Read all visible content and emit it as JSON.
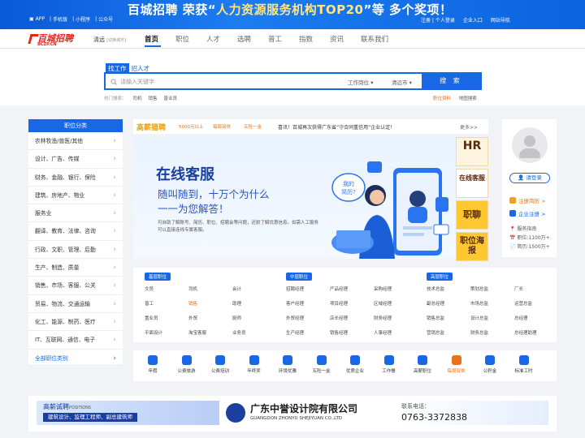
{
  "topbar": {
    "links": [
      "APP",
      "手机版",
      "小程序",
      "公众号"
    ],
    "banner_brand": "百城招聘",
    "banner_text_1": "荣获“",
    "banner_highlight": "人力资源服务机构TOP20",
    "banner_text_2": "”等 多个奖项！",
    "register_login": "注册 | 个人登录",
    "enterprise_entry": "企业入口",
    "site_nav": "网站导航"
  },
  "header": {
    "logo_main": "百城招聘",
    "logo_sub": "BCZP.CN",
    "city": "清远",
    "switch_city": "[切换城市]",
    "menu": [
      "首页",
      "职位",
      "人才",
      "选聘",
      "普工",
      "指数",
      "资讯",
      "联系我们"
    ],
    "active_menu": "首页"
  },
  "search": {
    "tab_jobs": "找工作",
    "tab_talent": "招人才",
    "placeholder": "请输入关键字",
    "job_type": "工作岗位",
    "city_select": "清远市",
    "button": "搜 索",
    "hot_label": "热门搜索：",
    "hot_terms": [
      "司机",
      "销售",
      "普业员"
    ],
    "fill_resume": "职位资料",
    "map_search": "地图搜索"
  },
  "categories": {
    "title": "职位分类",
    "items": [
      "农林牧渔/兽医/其他",
      "设计、广告、传媒",
      "财务、金融、银行、保险",
      "建筑、房地产、物业",
      "服务业",
      "翻译、教育、法律、咨询",
      "行政、文职、管理、后勤",
      "生产、制造、质量",
      "销售、市场、客服、公关",
      "贸易、物流、交通运输",
      "化工、能源、制药、医疗",
      "IT、互联网、通信、电子",
      "全部职位类别"
    ]
  },
  "ticker": {
    "brand": "高薪猎聘",
    "tags": [
      "5000元以上",
      "每周双休",
      "五险一金"
    ],
    "notice": "喜讯！百城再次获得广东省“守合同重信用”企业认定！",
    "more": "更多>>"
  },
  "hero": {
    "title": "在线客服",
    "line1": "随叫随到，十万个为什么",
    "line2": "一一为您解答！",
    "desc": "可自助了解账号、简历、职位、招聘会等问题，还耐了解优惠信息。如需人工服务可以直接连线专属客服。",
    "bubble": "我的简历?",
    "side_ads": [
      "HR",
      "在线客服",
      "职聊",
      "职位海报"
    ]
  },
  "user": {
    "login": "请登录",
    "register_resume": "注册简历 >",
    "register_company": "企业注册 >",
    "guide": "服务指南",
    "jobs_count": "职位:1100万+",
    "resume_count": "简历:1500万+"
  },
  "job_groups": [
    {
      "label": "基层职位",
      "items": [
        "文员",
        "司机",
        "会计",
        "普工",
        "销售",
        "助理",
        "置业员",
        "外贸",
        "厨师",
        "平面设计",
        "淘宝客服",
        "业务员"
      ],
      "highlight": "销售"
    },
    {
      "label": "中层职位",
      "items": [
        "招聘经理",
        "产品经理",
        "采购经理",
        "客户经理",
        "项目经理",
        "区域经理",
        "外贸经理",
        "店长经理",
        "财务经理",
        "生产经理",
        "销售经理",
        "人事经理"
      ]
    },
    {
      "label": "高层职位",
      "items": [
        "技术总监",
        "策划总监",
        "厂长",
        "副总经理",
        "市场总监",
        "运营总监",
        "销售总监",
        "设计总监",
        "总经理",
        "营销总监",
        "财务总监",
        "总经理助理"
      ]
    }
  ],
  "icons": [
    {
      "icon": "calendar-icon",
      "label": "年假"
    },
    {
      "icon": "meal-icon",
      "label": "公费旅游"
    },
    {
      "icon": "training-icon",
      "label": "公费培训"
    },
    {
      "icon": "bonus-icon",
      "label": "年终奖"
    },
    {
      "icon": "environment-icon",
      "label": "环境优雅"
    },
    {
      "icon": "insurance-icon",
      "label": "五险一金"
    },
    {
      "icon": "trophy-icon",
      "label": "优质企业"
    },
    {
      "icon": "meal-icon",
      "label": "工作餐"
    },
    {
      "icon": "salary-icon",
      "label": "高薪职位"
    },
    {
      "icon": "weekend-icon",
      "label": "每周双休",
      "highlight": true
    },
    {
      "icon": "housing-icon",
      "label": "公积金"
    },
    {
      "icon": "clock-icon",
      "label": "标准工时"
    }
  ],
  "bottom_ad": {
    "left_title": "高薪诚聘",
    "left_sub": "POSITIONS",
    "left_roles": "建筑设计、监理工程师、副总建筑师",
    "company": "广东中誉设计院有限公司",
    "company_en": "GUANGDON ZHONYU SHEJIYUAN CO.,LTD",
    "phone_label": "联系电话：",
    "phone": "0763-3372838"
  },
  "colors": {
    "primary": "#1868e5",
    "accent": "#e8731a",
    "logo_red": "#e8231a"
  }
}
